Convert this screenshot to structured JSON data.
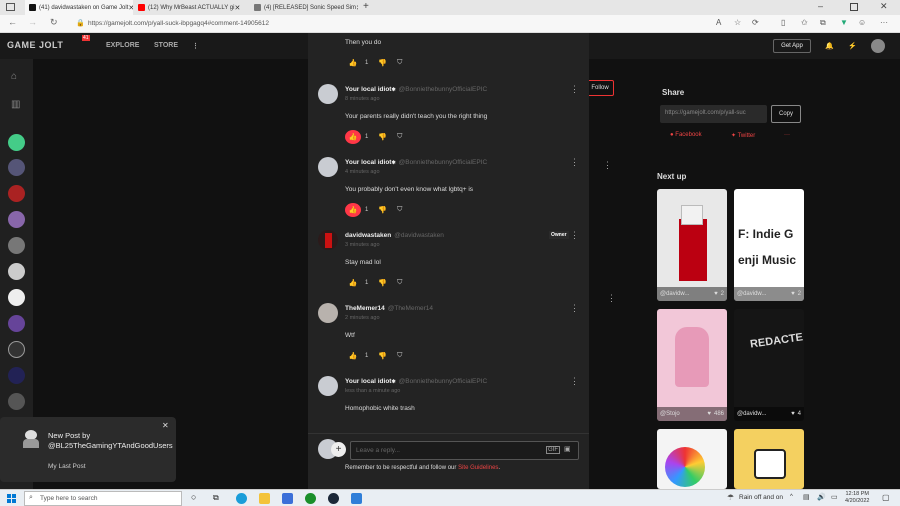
{
  "browser": {
    "tabs": [
      {
        "title": "(41) davidwastaken on Game Jolt",
        "color": "#111111"
      },
      {
        "title": "(12) Why MrBeast ACTUALLY gi",
        "color": "#ff0000"
      },
      {
        "title": "(4) [RELEASED] Sonic Speed Sim",
        "color": "#777777"
      }
    ],
    "url": "https://gamejolt.com/p/yall-suck-ibpgagq4#comment-14905612"
  },
  "site": {
    "logo": "GAME JOLT",
    "badge": "41",
    "nav": [
      "EXPLORE",
      "STORE"
    ],
    "get_app": "Get App"
  },
  "background": {
    "follow": "Follow",
    "share_title": "Share",
    "share_url": "https://gamejolt.com/p/yall-suc",
    "copy": "Copy",
    "facebook": "Facebook",
    "twitter": "Twitter",
    "next_up": "Next up",
    "cards": [
      {
        "user": "@davidw...",
        "likes": "2",
        "color": "#e8e8e8"
      },
      {
        "user": "@davidw...",
        "likes": "2",
        "color": "#ffffff"
      },
      {
        "user": "@Stojo",
        "likes": "486",
        "color": "#f2c7d8"
      },
      {
        "user": "@davidw...",
        "likes": "4",
        "color": "#151515"
      },
      {
        "user": "",
        "likes": "",
        "color": "#f4f4f4"
      },
      {
        "user": "",
        "likes": "",
        "color": "#f4d060"
      }
    ],
    "card2_text": "F: Indie G enji Music",
    "card4_text": "REDACTE"
  },
  "comments": [
    {
      "name": "",
      "handle": "",
      "time": "",
      "text": "Then you do",
      "likes": "1",
      "liked": false,
      "owner": false
    },
    {
      "name": "Your local idiot",
      "handle": "@BonniethebunnyOfficialEPIC",
      "time": "8 minutes ago",
      "text": "Your parents really didn't teach you the right thing",
      "likes": "1",
      "liked": true,
      "owner": false
    },
    {
      "name": "Your local idiot",
      "handle": "@BonniethebunnyOfficialEPIC",
      "time": "4 minutes ago",
      "text": "You probably don't even know what lgbtq+ is",
      "likes": "1",
      "liked": true,
      "owner": false
    },
    {
      "name": "davidwastaken",
      "handle": "@davidwastaken",
      "time": "3 minutes ago",
      "text": "Stay mad lol",
      "likes": "1",
      "liked": false,
      "owner": true,
      "owner_label": "Owner"
    },
    {
      "name": "TheMemer14",
      "handle": "@TheMemer14",
      "time": "2 minutes ago",
      "text": "Wtf",
      "likes": "1",
      "liked": false,
      "owner": false
    },
    {
      "name": "Your local idiot",
      "handle": "@BonniethebunnyOfficialEPIC",
      "time": "less than a minute ago",
      "text": "Homophobic white trash",
      "likes": "",
      "liked": false,
      "owner": false
    }
  ],
  "reply": {
    "placeholder": "Leave a reply...",
    "note": "Remember to be respectful and follow our",
    "link": "Site Guidelines",
    "period": "."
  },
  "notification": {
    "title": "New Post by @BL25TheGamingYTAndGoodUsers",
    "subtitle": "My Last Post"
  },
  "taskbar": {
    "search": "Type here to search",
    "weather": "Rain off and on",
    "time": "12:18 PM",
    "date": "4/20/2022"
  }
}
